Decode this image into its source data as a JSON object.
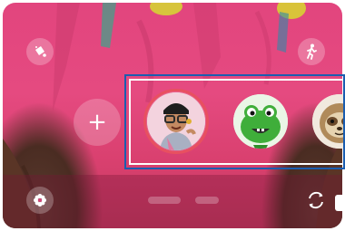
{
  "topbar": {
    "left_button_icon": "bucket-sparkle-icon",
    "right_button_icon": "walking-figure-icon"
  },
  "add_button": {
    "icon": "plus-icon",
    "label": "+"
  },
  "avatars": [
    {
      "name": "my-emoji-avatar",
      "selected": true,
      "icon": "person-avatar-icon"
    },
    {
      "name": "frog-avatar",
      "selected": false,
      "icon": "frog-avatar-icon"
    },
    {
      "name": "sloth-avatar",
      "selected": false,
      "icon": "sloth-avatar-icon"
    }
  ],
  "bottom": {
    "left_button_icon": "flower-filter-icon",
    "right_button_icon": "switch-camera-icon"
  },
  "colors": {
    "background": "#e2457e",
    "selection_outline": "#1a5db0",
    "selected_ring": "#e85060"
  }
}
